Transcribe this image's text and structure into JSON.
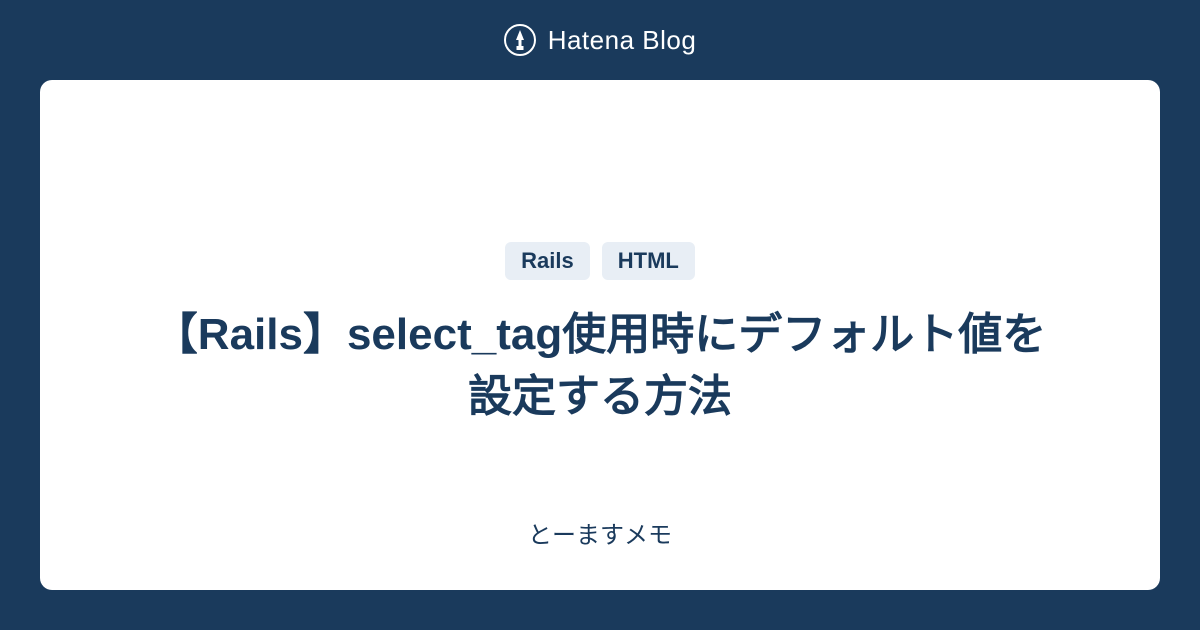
{
  "header": {
    "logo_text": "Hatena Blog"
  },
  "card": {
    "tags": [
      "Rails",
      "HTML"
    ],
    "title": "【Rails】select_tag使用時にデフォルト値を設定する方法",
    "subtitle": "とーますメモ"
  }
}
